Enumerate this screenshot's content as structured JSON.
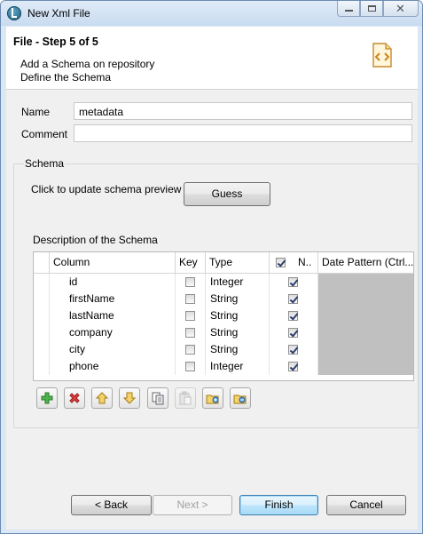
{
  "window": {
    "title": "New Xml File"
  },
  "header": {
    "step_title": "File - Step 5 of 5",
    "desc_line1": "Add a Schema on repository",
    "desc_line2": "Define the Schema",
    "icon": "xml-file-icon"
  },
  "form": {
    "name_label": "Name",
    "name_value": "metadata",
    "comment_label": "Comment",
    "comment_value": ""
  },
  "schema": {
    "group_label": "Schema",
    "update_text": "Click to update schema preview",
    "guess_label": "Guess",
    "description_label": "Description of the Schema",
    "columns": [
      "Column",
      "Key",
      "Type",
      "N..",
      "Date Pattern (Ctrl..."
    ],
    "nullable_header_checked": true,
    "rows": [
      {
        "column": "id",
        "key": false,
        "type": "Integer",
        "nullable": true
      },
      {
        "column": "firstName",
        "key": false,
        "type": "String",
        "nullable": true
      },
      {
        "column": "lastName",
        "key": false,
        "type": "String",
        "nullable": true
      },
      {
        "column": "company",
        "key": false,
        "type": "String",
        "nullable": true
      },
      {
        "column": "city",
        "key": false,
        "type": "String",
        "nullable": true
      },
      {
        "column": "phone",
        "key": false,
        "type": "Integer",
        "nullable": true
      }
    ]
  },
  "toolbar": {
    "buttons": [
      {
        "icon": "add-icon",
        "enabled": true
      },
      {
        "icon": "remove-icon",
        "enabled": true
      },
      {
        "icon": "move-up-icon",
        "enabled": true
      },
      {
        "icon": "move-down-icon",
        "enabled": true
      },
      {
        "icon": "copy-icon",
        "enabled": true
      },
      {
        "icon": "paste-icon",
        "enabled": false
      },
      {
        "icon": "import-icon",
        "enabled": true
      },
      {
        "icon": "export-icon",
        "enabled": true
      }
    ]
  },
  "footer": {
    "back_label": "< Back",
    "next_label": "Next >",
    "finish_label": "Finish",
    "cancel_label": "Cancel"
  }
}
